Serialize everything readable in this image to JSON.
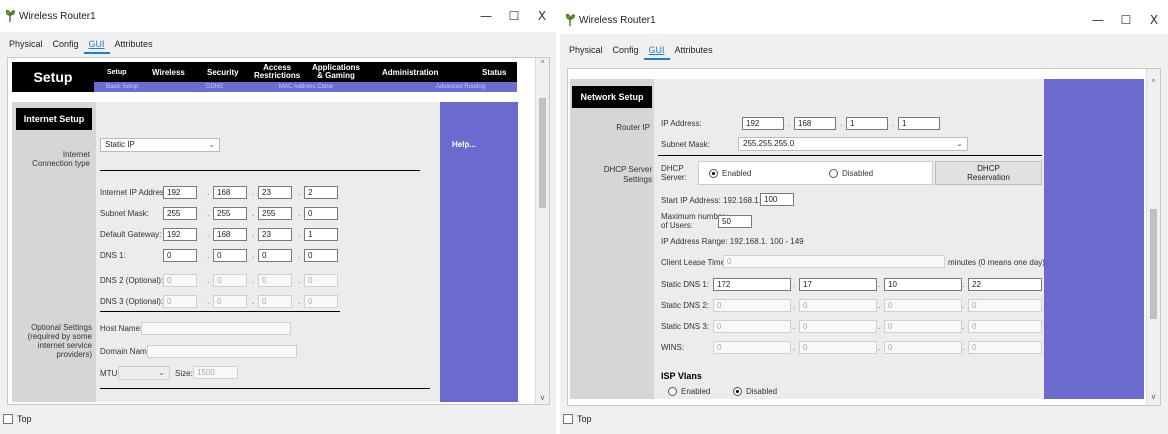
{
  "colors": {
    "accent": "#1e7fd0",
    "purple": "#6a6acf",
    "nav": "#000000"
  },
  "left": {
    "title": "Wireless Router1",
    "controls": {
      "minimize": "—",
      "maximize": "☐",
      "close": "X"
    },
    "tabs": [
      "Physical",
      "Config",
      "GUI",
      "Attributes"
    ],
    "nav": {
      "setup": "Setup",
      "items": [
        "Setup",
        "Wireless",
        "Security",
        "Access\nRestrictions",
        "Applications\n& Gaming",
        "Administration",
        "Status"
      ],
      "sub": [
        "Basic Setup",
        "DDNS",
        "MAC Address Clone",
        "Advanced Routing"
      ]
    },
    "section": "Internet Setup",
    "conn_label": "Internet\nConnection type",
    "conn_type": "Static IP",
    "help": "Help...",
    "fields": [
      {
        "label": "Internet IP Address:",
        "vals": [
          "192",
          "168",
          "23",
          "2"
        ]
      },
      {
        "label": "Subnet Mask:",
        "vals": [
          "255",
          "255",
          "255",
          "0"
        ]
      },
      {
        "label": "Default Gateway:",
        "vals": [
          "192",
          "168",
          "23",
          "1"
        ]
      },
      {
        "label": "DNS 1:",
        "vals": [
          "0",
          "0",
          "0",
          "0"
        ]
      },
      {
        "label": "DNS 2 (Optional):",
        "vals": [
          "0",
          "0",
          "0",
          "0"
        ]
      },
      {
        "label": "DNS 3 (Optional):",
        "vals": [
          "0",
          "0",
          "0",
          "0"
        ]
      }
    ],
    "optional_label": "Optional Settings\n(required by some\ninternet service\nproviders)",
    "host_name": "Host Name:",
    "domain_name": "Domain Name:",
    "mtu": "MTU:",
    "size": "Size:",
    "size_val": "1500",
    "top": "Top"
  },
  "right": {
    "title": "Wireless Router1",
    "controls": {
      "minimize": "—",
      "maximize": "☐",
      "close": "X"
    },
    "tabs": [
      "Physical",
      "Config",
      "GUI",
      "Attributes"
    ],
    "section": "Network Setup",
    "router_ip": "Router IP",
    "ip_label": "IP Address:",
    "ip": [
      "192",
      "168",
      "1",
      "1"
    ],
    "mask_label": "Subnet Mask:",
    "mask": "255.255.255.0",
    "dhcp_label": "DHCP Server\nSettings",
    "dhcp_server": "DHCP\nServer:",
    "enabled": "Enabled",
    "disabled": "Disabled",
    "dhcp_res": "DHCP\nReservation",
    "start_ip": "Start IP Address:  192.168.1.",
    "start_val": "100",
    "max_users": "Maximum number\nof Users:",
    "max_val": "50",
    "ip_range": "IP Address Range:  192.168.1.  100  -  149",
    "lease": "Client Lease Time:",
    "lease_val": "0",
    "lease_note": "minutes (0 means one day)",
    "dns": [
      {
        "label": "Static DNS 1:",
        "vals": [
          "172",
          "17",
          "10",
          "22"
        ]
      },
      {
        "label": "Static DNS 2:",
        "vals": [
          "0",
          "0",
          "0",
          "0"
        ]
      },
      {
        "label": "Static DNS 3:",
        "vals": [
          "0",
          "0",
          "0",
          "0"
        ]
      },
      {
        "label": "WINS:",
        "vals": [
          "0",
          "0",
          "0",
          "0"
        ]
      }
    ],
    "isp": "ISP Vlans",
    "isp_enabled": "Enabled",
    "isp_disabled": "Disabled",
    "top": "Top"
  }
}
